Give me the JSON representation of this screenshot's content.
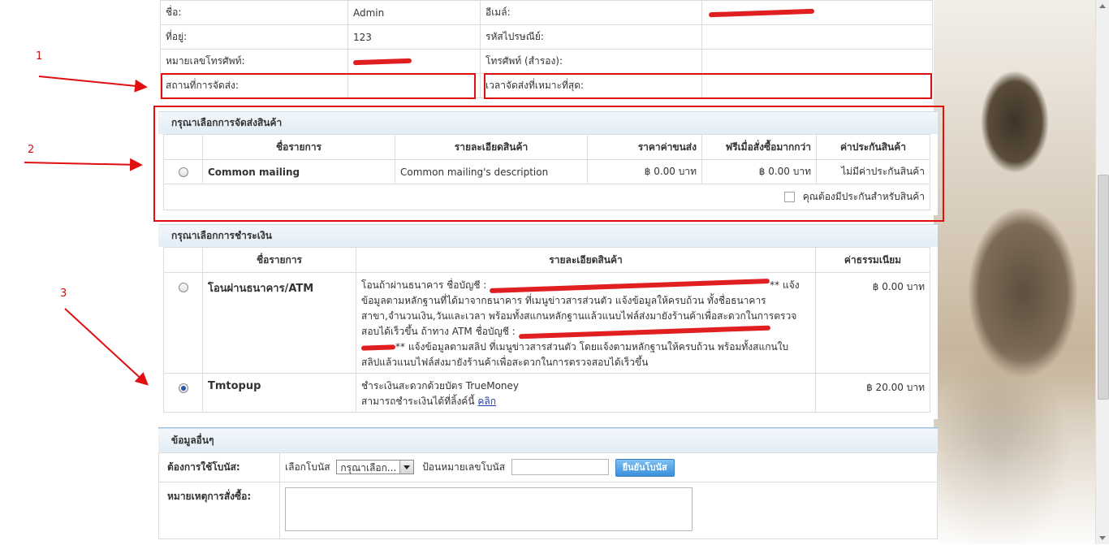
{
  "customer": {
    "name_label": "ชื่อ:",
    "name_value": "Admin",
    "email_label": "อีเมล์:",
    "address_label": "ที่อยู่:",
    "address_value": "123",
    "postcode_label": "รหัสไปรษณีย์:",
    "phone_label": "หมายเลขโทรศัพท์:",
    "alt_phone_label": "โทรศัพท์ (สำรอง):",
    "shipping_place_label": "สถานที่การจัดส่ง:",
    "delivery_time_label": "เวลาจัดส่งที่เหมาะที่สุด:"
  },
  "shipping": {
    "title": "กรุณาเลือกการจัดส่งสินค้า",
    "headers": [
      "ชื่อรายการ",
      "รายละเอียดสินค้า",
      "ราคาค่าขนส่ง",
      "ฟรีเมื่อสั่งซื้อมากกว่า",
      "ค่าประกันสินค้า"
    ],
    "rows": [
      {
        "name": "Common mailing",
        "description": "Common mailing's description",
        "price": "฿ 0.00 บาท",
        "free_over": "฿ 0.00 บาท",
        "insurance": "ไม่มีค่าประกันสินค้า"
      }
    ],
    "insurance_checkbox_label": "คุณต้องมีประกันสำหรับสินค้า"
  },
  "payment": {
    "title": "กรุณาเลือกการชำระเงิน",
    "headers": [
      "ชื่อรายการ",
      "รายละเอียดสินค้า",
      "ค่าธรรมเนียม"
    ],
    "rows": [
      {
        "name": "โอนผ่านธนาคาร/ATM",
        "desc_line1_a": "โอนถ้าผ่านธนาคาร ชื่อบัญชี :",
        "desc_line1_b": "** แจ้ง",
        "desc_line2": "ข้อมูลตามหลักฐานที่ได้มาจากธนาคาร ที่เมนูข่าวสารส่วนตัว แจ้งข้อมูลให้ครบถ้วน ทั้งชื่อธนาคาร",
        "desc_line3": "สาขา,จำนวนเงิน,วันและเวลา พร้อมทั้งสแกนหลักฐานแล้วแนบไฟล์ส่งมายังร้านค้าเพื่อสะดวกในการตรวจ",
        "desc_line4": "สอบได้เร็วขึ้น ถ้าทาง ATM ชื่อบัญชี :",
        "desc_line5": "** แจ้งข้อมูลตามสลิป ที่เมนูข่าวสารส่วนตัว โดยแจ้งตามหลักฐานให้ครบถ้วน พร้อมทั้งสแกนใบ",
        "desc_line6": "สลิปแล้วแนบไฟล์ส่งมายังร้านค้าเพื่อสะดวกในการตรวจสอบได้เร็วขึ้น",
        "fee": "฿ 0.00 บาท",
        "selected": false
      },
      {
        "name": "Tmtopup",
        "desc_line1": "ชำระเงินสะดวกด้วยบัตร TrueMoney",
        "desc_line2": "สามารถชำระเงินได้ที่ลิ้งค์นี้",
        "link_text": "คลิก",
        "fee": "฿ 20.00 บาท",
        "selected": true
      }
    ]
  },
  "other": {
    "title": "ข้อมูลอื่นๆ",
    "bonus_label": "ต้องการใช้โบนัส:",
    "choose_bonus_label": "เลือกโบนัส",
    "bonus_select_value": "กรุณาเลือก...",
    "enter_bonus_label": "ป้อนหมายเลขโบนัส",
    "confirm_bonus_button": "ยืนยันโบนัส",
    "note_label": "หมายเหตุการสั่งซื้อ:"
  },
  "annotations": [
    "1",
    "2",
    "3"
  ],
  "colors": {
    "annotation": "#e01010",
    "section_bg": "#e8f1f8",
    "button": "#3a8fda",
    "link": "#1f3ea8"
  }
}
